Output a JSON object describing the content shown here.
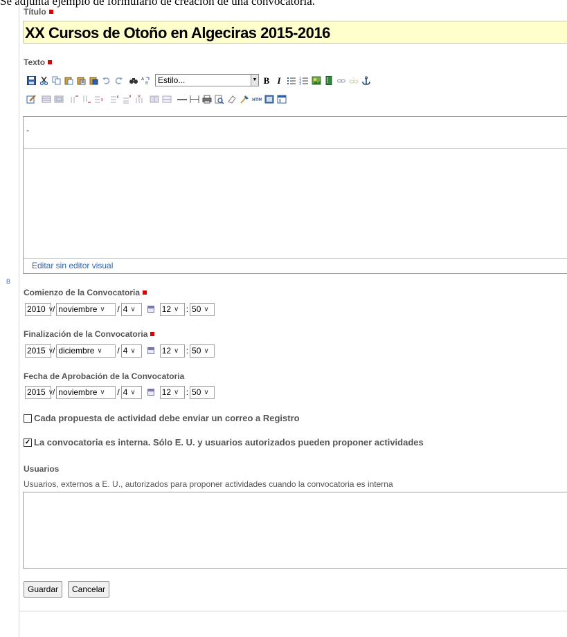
{
  "intro_text": "Se adjunta ejemplo de formulario de creación de una convocatoria.",
  "margin_marker": "B",
  "titulo": {
    "label": "Título",
    "value": "XX Cursos de Otoño en Algeciras 2015-2016"
  },
  "texto": {
    "label": "Texto",
    "style_select": "Estilo...",
    "content": "-",
    "visual_link": "Editar sin editor visual",
    "toolbar_row1": [
      "save-icon",
      "cut-icon",
      "copy-icon",
      "paste-icon",
      "paste-text-icon",
      "paste-word-icon",
      "undo-icon",
      "redo-icon",
      "find-icon",
      "replace-icon"
    ],
    "toolbar_row1b": [
      "bold-icon",
      "italic-icon",
      "unordered-list-icon",
      "ordered-list-icon",
      "image-icon",
      "media-icon",
      "link-icon",
      "unlink-icon",
      "anchor-icon"
    ],
    "toolbar_row2": [
      "edit-icon",
      "table-icon",
      "table-props-icon",
      "insert-row-before-icon",
      "insert-row-after-icon",
      "delete-row-icon",
      "insert-col-before-icon",
      "insert-col-after-icon",
      "delete-col-icon",
      "merge-cells-icon",
      "split-cells-icon",
      "hr-icon",
      "page-break-icon",
      "print-icon",
      "preview-icon",
      "cleanup-icon",
      "format-painter-icon",
      "html-icon",
      "fullscreen-icon",
      "template-icon"
    ]
  },
  "comienzo": {
    "label": "Comienzo de la Convocatoria",
    "year": "2010",
    "month": "noviembre",
    "day": "4",
    "hour": "12",
    "minute": "50"
  },
  "finalizacion": {
    "label": "Finalización de la Convocatoria",
    "year": "2015",
    "month": "diciembre",
    "day": "4",
    "hour": "12",
    "minute": "50"
  },
  "aprobacion": {
    "label": "Fecha de Aprobación de la Convocatoria",
    "year": "2015",
    "month": "noviembre",
    "day": "4",
    "hour": "12",
    "minute": "50"
  },
  "separators": {
    "date": "/",
    "time": ":"
  },
  "check_registro": {
    "label": "Cada propuesta de actividad debe enviar un correo a Registro",
    "checked": false
  },
  "check_interna": {
    "label": "La convocatoria es interna. Sólo E. U. y usuarios autorizados pueden proponer actividades",
    "checked": true,
    "mark": "✓"
  },
  "usuarios": {
    "label": "Usuarios",
    "help": "Usuarios, externos a E. U., autorizados para proponer actividades cuando la convocatoria es interna",
    "value": ""
  },
  "buttons": {
    "save": "Guardar",
    "cancel": "Cancelar"
  },
  "colors": {
    "required_marker": "#e00000",
    "title_bg": "#ffffcc",
    "link": "#2d63b5"
  }
}
